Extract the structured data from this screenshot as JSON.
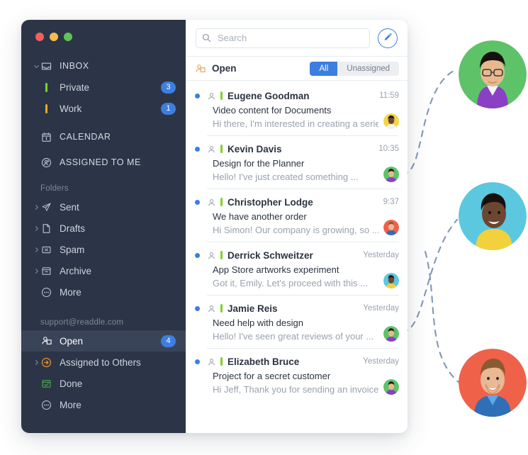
{
  "window": {
    "traffic_lights": [
      {
        "name": "close",
        "color": "#f1605d"
      },
      {
        "name": "minimize",
        "color": "#f5bd4f"
      },
      {
        "name": "maximize",
        "color": "#5fc454"
      }
    ]
  },
  "sidebar": {
    "background": "#2c3547",
    "selected_background": "#3a4459",
    "badge_color": "#3d7ee0",
    "top_items": [
      {
        "label": "INBOX",
        "icon": "inbox-icon",
        "caps": true,
        "disclosure": "chevron-down",
        "badge": ""
      },
      {
        "label": "Private",
        "icon": "tag-bar",
        "tag_color": "#7ed321",
        "caps": false,
        "badge": "3"
      },
      {
        "label": "Work",
        "icon": "tag-bar",
        "tag_color": "#f5a623",
        "caps": false,
        "badge": "1"
      },
      {
        "label": "CALENDAR",
        "icon": "calendar-icon",
        "caps": true,
        "badge": ""
      },
      {
        "label": "ASSIGNED TO ME",
        "icon": "assigned-to-me-icon",
        "caps": true,
        "badge": ""
      }
    ],
    "folders_title": "Folders",
    "folders": [
      {
        "label": "Sent",
        "icon": "send-icon",
        "disclosure": "chevron-right"
      },
      {
        "label": "Drafts",
        "icon": "document-icon",
        "disclosure": "chevron-right"
      },
      {
        "label": "Spam",
        "icon": "spam-icon",
        "disclosure": "chevron-right"
      },
      {
        "label": "Archive",
        "icon": "archive-icon",
        "disclosure": "chevron-right"
      },
      {
        "label": "More",
        "icon": "more-icon",
        "disclosure": ""
      }
    ],
    "account_title": "support@readdle.com",
    "account_items": [
      {
        "label": "Open",
        "icon": "open-assign-icon",
        "icon_color": "#ffffff",
        "badge": "4",
        "selected": true,
        "disclosure": ""
      },
      {
        "label": "Assigned to Others",
        "icon": "arrow-circle-icon",
        "icon_color": "#e8943a",
        "badge": "",
        "selected": false,
        "disclosure": "chevron-right"
      },
      {
        "label": "Done",
        "icon": "done-check-icon",
        "icon_color": "#4ca64c",
        "badge": "",
        "selected": false,
        "disclosure": ""
      },
      {
        "label": "More",
        "icon": "more-icon",
        "icon_color": "#b9c1cf",
        "badge": "",
        "selected": false,
        "disclosure": ""
      }
    ]
  },
  "search": {
    "placeholder": "Search",
    "value": "",
    "icon": "search-icon",
    "compose_icon": "pencil-icon"
  },
  "list_header": {
    "icon": "open-assign-icon",
    "title": "Open",
    "segments": [
      {
        "label": "All",
        "active": true
      },
      {
        "label": "Unassigned",
        "active": false
      }
    ]
  },
  "messages": [
    {
      "unread": true,
      "tag_color": "#7ed321",
      "name": "Eugene Goodman",
      "time": "11:59",
      "subject": "Video content for Documents",
      "preview": "Hi there, I'm interested in creating a series",
      "avatar": {
        "bg": "#f5d547",
        "skin": "#6b4630",
        "hair": "#1d1410",
        "shirt": "#f0f3f6"
      }
    },
    {
      "unread": true,
      "tag_color": "#7ed321",
      "name": "Kevin Davis",
      "time": "10:35",
      "subject": "Design for the Planner",
      "preview": "Hello! I've just created something ...",
      "avatar": {
        "bg": "#5ec269",
        "skin": "#e8b98f",
        "hair": "#1d1410",
        "shirt": "#8b3fc4"
      }
    },
    {
      "unread": true,
      "tag_color": "#7ed321",
      "name": "Christopher Lodge",
      "time": "9:37",
      "subject": "We have another order",
      "preview": "Hi Simon! Our company is growing, so ...",
      "avatar": {
        "bg": "#f0614a",
        "skin": "#eab894",
        "hair": "#8a5a32",
        "shirt": "#2f6fb8"
      }
    },
    {
      "unread": true,
      "tag_color": "#7ed321",
      "name": "Derrick Schweitzer",
      "time": "Yesterday",
      "subject": "App Store artworks experiment",
      "preview": "Got it, Emily. Let's proceed with this ...",
      "avatar": {
        "bg": "#5bc8e0",
        "skin": "#6b4630",
        "hair": "#1d1410",
        "shirt": "#f2d23c"
      }
    },
    {
      "unread": true,
      "tag_color": "#7ed321",
      "name": "Jamie Reis",
      "time": "Yesterday",
      "subject": "Need help with design",
      "preview": "Hello! I've seen great reviews of your ...",
      "avatar": {
        "bg": "#5ec269",
        "skin": "#e8b98f",
        "hair": "#1d1410",
        "shirt": "#8b3fc4"
      }
    },
    {
      "unread": true,
      "tag_color": "#7ed321",
      "name": "Elizabeth Bruce",
      "time": "Yesterday",
      "subject": "Project for a secret customer",
      "preview": "Hi Jeff, Thank you for sending an invoice",
      "avatar": {
        "bg": "#5ec269",
        "skin": "#e8b98f",
        "hair": "#1d1410",
        "shirt": "#8b3fc4"
      }
    }
  ],
  "big_avatars": [
    {
      "name": "avatar-green",
      "bg": "#5ec269",
      "skin": "#e8b98f",
      "hair": "#17110d",
      "shirt": "#8b3fc4",
      "glasses": true
    },
    {
      "name": "avatar-cyan",
      "bg": "#5bc8e0",
      "skin": "#6b4630",
      "hair": "#17110d",
      "shirt": "#f2d23c",
      "glasses": false
    },
    {
      "name": "avatar-coral",
      "bg": "#f0614a",
      "skin": "#eab894",
      "hair": "#8a5a32",
      "shirt": "#2f6fb8",
      "glasses": false
    }
  ],
  "connector": {
    "color": "#7f96b8",
    "style": "dashed"
  }
}
